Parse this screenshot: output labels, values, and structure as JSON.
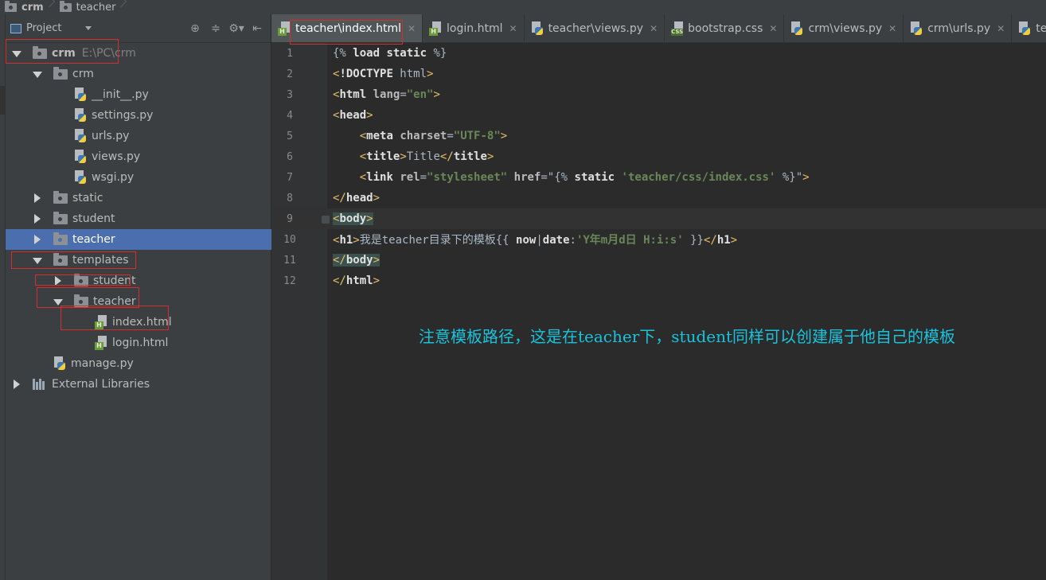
{
  "breadcrumb": [
    "crm",
    "teacher"
  ],
  "project_panel": {
    "title": "Project",
    "tree": [
      {
        "label": "crm",
        "extra": "E:\\PC\\crm",
        "type": "folder",
        "expanded": true,
        "depth": 0,
        "bold": true
      },
      {
        "label": "crm",
        "type": "folder",
        "expanded": true,
        "depth": 1
      },
      {
        "label": "__init__.py",
        "type": "py",
        "depth": 2
      },
      {
        "label": "settings.py",
        "type": "py",
        "depth": 2
      },
      {
        "label": "urls.py",
        "type": "py",
        "depth": 2
      },
      {
        "label": "views.py",
        "type": "py",
        "depth": 2
      },
      {
        "label": "wsgi.py",
        "type": "py",
        "depth": 2
      },
      {
        "label": "static",
        "type": "folder",
        "expanded": false,
        "depth": 1
      },
      {
        "label": "student",
        "type": "folder",
        "expanded": false,
        "depth": 1
      },
      {
        "label": "teacher",
        "type": "folder",
        "expanded": false,
        "depth": 1,
        "selected": true
      },
      {
        "label": "templates",
        "type": "folder",
        "expanded": true,
        "depth": 1
      },
      {
        "label": "student",
        "type": "folder",
        "expanded": false,
        "depth": 2
      },
      {
        "label": "teacher",
        "type": "folder",
        "expanded": true,
        "depth": 2
      },
      {
        "label": "index.html",
        "type": "html",
        "depth": 3
      },
      {
        "label": "login.html",
        "type": "html",
        "depth": 3
      },
      {
        "label": "manage.py",
        "type": "py",
        "depth": 1
      },
      {
        "label": "External Libraries",
        "type": "lib",
        "expanded": false,
        "depth": 0
      }
    ]
  },
  "tabs": [
    {
      "label": "teacher\\index.html",
      "icon": "html",
      "active": true
    },
    {
      "label": "login.html",
      "icon": "html"
    },
    {
      "label": "teacher\\views.py",
      "icon": "py"
    },
    {
      "label": "bootstrap.css",
      "icon": "css"
    },
    {
      "label": "crm\\views.py",
      "icon": "py"
    },
    {
      "label": "crm\\urls.py",
      "icon": "py"
    },
    {
      "label": "teacher\\u",
      "icon": "py"
    }
  ],
  "editor": {
    "line_numbers": [
      "1",
      "2",
      "3",
      "4",
      "5",
      "6",
      "7",
      "8",
      "9",
      "10",
      "11",
      "12"
    ],
    "current_line": 9,
    "lines": [
      "{% load static %}",
      "<!DOCTYPE html>",
      "<html lang=\"en\">",
      "<head>",
      "    <meta charset=\"UTF-8\">",
      "    <title>Title</title>",
      "    <link rel=\"stylesheet\" href=\"{% static 'teacher/css/index.css' %}\">",
      "</head>",
      "<body>",
      "<h1>我是teacher目录下的模板{{ now|date:'Y年m月d日 H:i:s' }}</h1>",
      "</body>",
      "</html>"
    ]
  },
  "annotation": "注意模板路径，这是在teacher下，student同样可以创建属于他自己的模板",
  "colors": {
    "annotation": "#19c3dc",
    "highlight_box": "#d32f2f",
    "selection": "#4b6eaf"
  }
}
